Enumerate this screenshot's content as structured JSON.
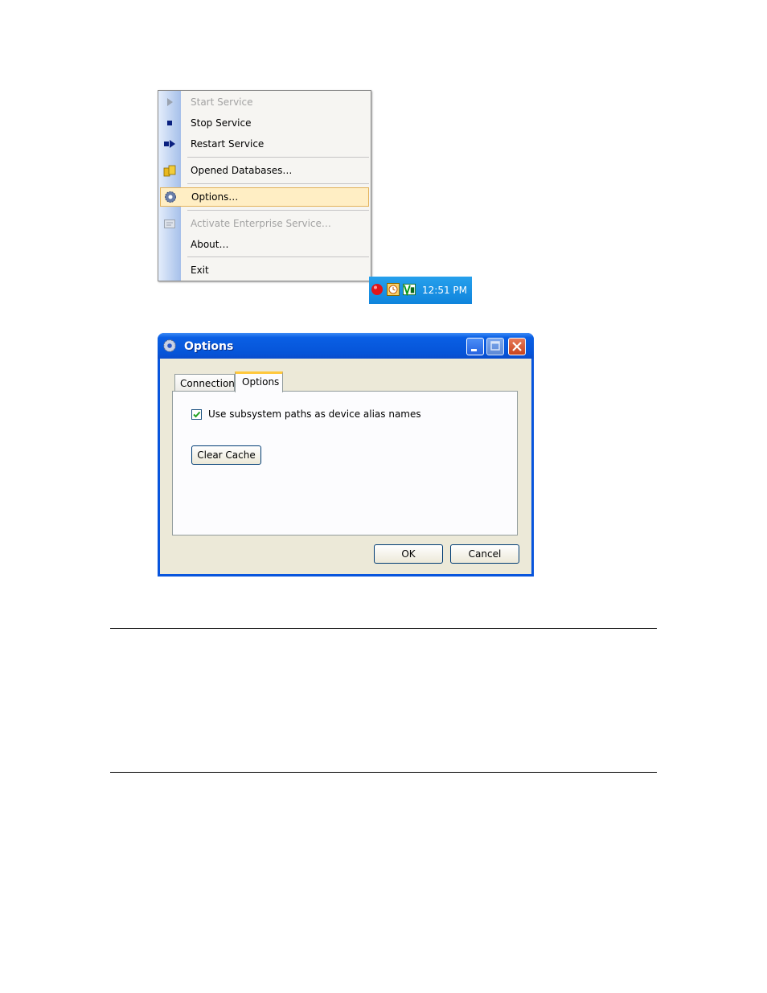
{
  "menu": {
    "items": [
      {
        "label": "Start Service",
        "disabled": true,
        "icon": "play-icon"
      },
      {
        "label": "Stop Service",
        "disabled": false,
        "icon": "stop-icon"
      },
      {
        "label": "Restart Service",
        "disabled": false,
        "icon": "restart-icon"
      },
      {
        "label": "Opened Databases…",
        "disabled": false,
        "icon": "database-icon"
      },
      {
        "label": "Options…",
        "disabled": false,
        "highlighted": true,
        "icon": "gear-icon"
      },
      {
        "label": "Activate Enterprise Service…",
        "disabled": true,
        "icon": "certificate-icon"
      },
      {
        "label": "About…",
        "disabled": false
      },
      {
        "label": "Exit",
        "disabled": false
      }
    ]
  },
  "tray": {
    "clock": "12:51 PM"
  },
  "dialog": {
    "title": "Options",
    "tabs": [
      {
        "label": "Connection"
      },
      {
        "label": "Options",
        "active": true
      }
    ],
    "checkbox_label": "Use subsystem paths as device alias names",
    "checkbox_checked": true,
    "clear_cache_label": "Clear Cache",
    "ok_label": "OK",
    "cancel_label": "Cancel"
  },
  "colors": {
    "titlebar": "#0a5fe4",
    "highlight": "#ffeec4",
    "taskbar": "#1a90e4"
  }
}
